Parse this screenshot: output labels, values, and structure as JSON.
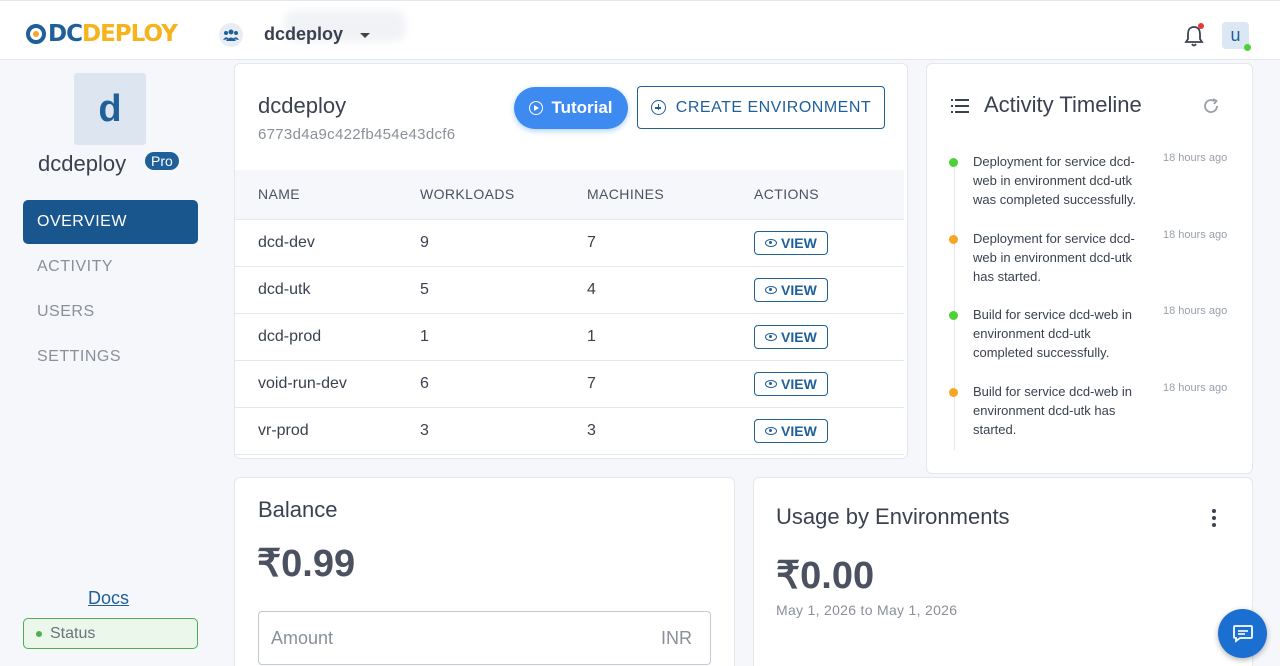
{
  "brand": {
    "logo_part1": "DC",
    "logo_part2": "DEPLOY"
  },
  "header": {
    "team_name": "dcdeploy",
    "user_initial": "u"
  },
  "sidebar": {
    "org_initial": "d",
    "org_name": "dcdeploy",
    "plan_badge": "Pro",
    "nav": [
      {
        "label": "OVERVIEW",
        "active": true
      },
      {
        "label": "ACTIVITY",
        "active": false
      },
      {
        "label": "USERS",
        "active": false
      },
      {
        "label": "SETTINGS",
        "active": false
      }
    ],
    "docs_label": "Docs",
    "status_label": "Status"
  },
  "environments": {
    "title": "dcdeploy",
    "id": "6773d4a9c422fb454e43dcf6",
    "tutorial_label": "Tutorial",
    "create_label": "CREATE ENVIRONMENT",
    "columns": [
      "NAME",
      "WORKLOADS",
      "MACHINES",
      "ACTIONS"
    ],
    "view_label": "VIEW",
    "rows": [
      {
        "name": "dcd-dev",
        "workloads": "9",
        "machines": "7"
      },
      {
        "name": "dcd-utk",
        "workloads": "5",
        "machines": "4"
      },
      {
        "name": "dcd-prod",
        "workloads": "1",
        "machines": "1"
      },
      {
        "name": "void-run-dev",
        "workloads": "6",
        "machines": "7"
      },
      {
        "name": "vr-prod",
        "workloads": "3",
        "machines": "3"
      }
    ]
  },
  "activity": {
    "title": "Activity Timeline",
    "items": [
      {
        "text": "Deployment for service dcd-web in environment dcd-utk was completed successfully.",
        "time": "18 hours ago",
        "status_color": "#4cd137"
      },
      {
        "text": "Deployment for service dcd-web in environment dcd-utk has started.",
        "time": "18 hours ago",
        "status_color": "#f5a623"
      },
      {
        "text": "Build for service dcd-web in environment dcd-utk completed successfully.",
        "time": "18 hours ago",
        "status_color": "#4cd137"
      },
      {
        "text": "Build for service dcd-web in environment dcd-utk has started.",
        "time": "18 hours ago",
        "status_color": "#f5a623"
      }
    ]
  },
  "balance": {
    "title": "Balance",
    "amount": "₹0.99",
    "input_placeholder": "Amount",
    "input_suffix": "INR"
  },
  "usage": {
    "title": "Usage by Environments",
    "amount": "₹0.00",
    "range": "May 1, 2026 to May 1, 2026"
  },
  "colors": {
    "primary": "#1a568e",
    "accent": "#3d8bf0",
    "brand_yellow": "#f5b31c",
    "success": "#4cd137",
    "warning": "#f5a623"
  }
}
